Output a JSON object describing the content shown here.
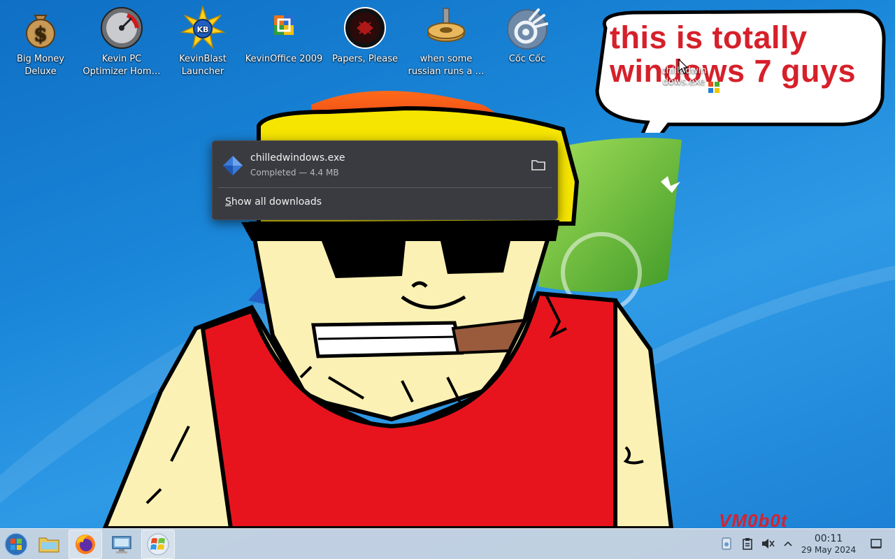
{
  "desktop": {
    "icons": [
      {
        "label": "Big Money Deluxe",
        "icon": "money-bag-icon"
      },
      {
        "label": "Kevin PC Optimizer Hom…",
        "icon": "speedometer-icon"
      },
      {
        "label": "KevinBlast Launcher",
        "icon": "blast-star-icon"
      },
      {
        "label": "KevinOffice 2009",
        "icon": "office-icon"
      },
      {
        "label": "Papers, Please",
        "icon": "papers-please-icon"
      },
      {
        "label": "when some russian runs a …",
        "icon": "gear-icon"
      },
      {
        "label": "Cốc Cốc",
        "icon": "coccoc-browser-icon"
      }
    ],
    "speech_bubble": {
      "line1": "this is totally",
      "line2": "windows 7 guys"
    },
    "file_icon": {
      "label_line1": "chilledwin",
      "label_line2": "dows.exe",
      "icon": "exe-file-icon"
    },
    "watermark": "VM0b0t"
  },
  "downloads_popup": {
    "file_name": "chilledwindows.exe",
    "status": "Completed — 4.4 MB",
    "show_all_prefix": "S",
    "show_all_rest": "how all downloads"
  },
  "taskbar": {
    "items": [
      {
        "name": "start-button",
        "icon": "windows-orb-icon"
      },
      {
        "name": "file-manager",
        "icon": "folder-icon"
      },
      {
        "name": "firefox",
        "icon": "firefox-icon"
      },
      {
        "name": "system-settings",
        "icon": "computer-icon"
      },
      {
        "name": "chilledwindows",
        "icon": "windows-logo-icon"
      }
    ],
    "clock": {
      "time": "00:11",
      "date": "29 May 2024"
    }
  }
}
